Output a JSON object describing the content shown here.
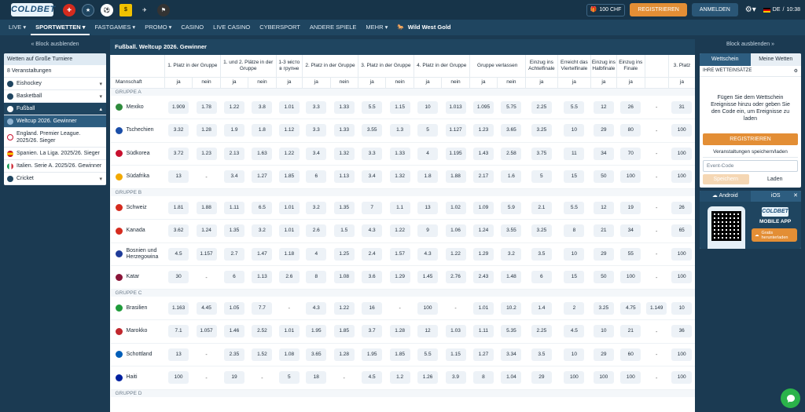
{
  "header": {
    "logo": "COLDBET",
    "balance": "100 CHF",
    "register": "REGISTRIEREN",
    "login": "ANMELDEN",
    "lang": "DE",
    "time": "10:38"
  },
  "nav": [
    "LIVE",
    "SPORTWETTEN",
    "FASTGAMES",
    "PROMO",
    "CASINO",
    "LIVE CASINO",
    "CYBERSPORT",
    "ANDERE SPIELE",
    "MEHR",
    "Wild West Gold"
  ],
  "left": {
    "hide": "Block ausblenden",
    "section": "Wetten auf Große Turniere",
    "events": "8 Veranstaltungen",
    "sports": {
      "eishockey": "Eishockey",
      "basketball": "Basketball",
      "fussball": "Fußball",
      "cricket": "Cricket"
    },
    "leagues": [
      "Weltcup 2026. Gewinner",
      "England. Premier League. 2025/26. Sieger",
      "Spanien. La Liga. 2025/26. Sieger",
      "Italien. Serie A. 2025/26. Gewinner"
    ]
  },
  "main": {
    "title": "Fußball. Weltcup 2026. Gewinner",
    "headers": [
      "1. Platz in der Gruppe",
      "1. und 2. Plätze in der Gruppe",
      "1-3 місто в групне",
      "2. Platz in der Gruppe",
      "3. Platz in der Gruppe",
      "4. Platz in der Gruppe",
      "Gruppe verlassen",
      "Einzug ins Achtelfinale",
      "Erreicht das Viertelfinale",
      "Einzug ins Halbfinale",
      "Einzug ins Finale",
      "3. Platz"
    ],
    "sub": {
      "team": "Mannschaft",
      "yes": "ja",
      "no": "nein"
    },
    "groups": [
      {
        "name": "GRUPPE A",
        "teams": [
          {
            "name": "Mexiko",
            "flag": "#2e8b3c",
            "odds": [
              "1.909",
              "1.78",
              "1.22",
              "3.8",
              "1.01",
              "3.3",
              "1.33",
              "5.5",
              "1.15",
              "10",
              "1.013",
              "1.095",
              "5.75",
              "2.25",
              "5.5",
              "12",
              "26",
              "-",
              "31"
            ]
          },
          {
            "name": "Tschechien",
            "flag": "#1b4ea8",
            "odds": [
              "3.32",
              "1.28",
              "1.9",
              "1.8",
              "1.12",
              "3.3",
              "1.33",
              "3.55",
              "1.3",
              "5",
              "1.127",
              "1.23",
              "3.65",
              "3.25",
              "10",
              "29",
              "80",
              "-",
              "100"
            ]
          },
          {
            "name": "Südkorea",
            "flag": "#c8102e",
            "odds": [
              "3.72",
              "1.23",
              "2.13",
              "1.63",
              "1.22",
              "3.4",
              "1.32",
              "3.3",
              "1.33",
              "4",
              "1.195",
              "1.43",
              "2.58",
              "3.75",
              "11",
              "34",
              "70",
              "-",
              "100"
            ]
          },
          {
            "name": "Südafrika",
            "flag": "#f2a900",
            "odds": [
              "13",
              "-",
              "3.4",
              "1.27",
              "1.85",
              "6",
              "1.13",
              "3.4",
              "1.32",
              "1.8",
              "1.88",
              "2.17",
              "1.6",
              "5",
              "15",
              "50",
              "100",
              "-",
              "100"
            ]
          }
        ]
      },
      {
        "name": "GRUPPE B",
        "teams": [
          {
            "name": "Schweiz",
            "flag": "#d52b1e",
            "odds": [
              "1.81",
              "1.88",
              "1.11",
              "6.5",
              "1.01",
              "3.2",
              "1.35",
              "7",
              "1.1",
              "13",
              "1.02",
              "1.09",
              "5.9",
              "2.1",
              "5.5",
              "12",
              "19",
              "-",
              "26"
            ]
          },
          {
            "name": "Kanada",
            "flag": "#d52b1e",
            "odds": [
              "3.62",
              "1.24",
              "1.35",
              "3.2",
              "1.01",
              "2.6",
              "1.5",
              "4.3",
              "1.22",
              "9",
              "1.06",
              "1.24",
              "3.55",
              "3.25",
              "8",
              "21",
              "34",
              "-",
              "65"
            ]
          },
          {
            "name": "Bosnien und Herzegowina",
            "flag": "#1f3c99",
            "odds": [
              "4.5",
              "1.157",
              "2.7",
              "1.47",
              "1.18",
              "4",
              "1.25",
              "2.4",
              "1.57",
              "4.3",
              "1.22",
              "1.29",
              "3.2",
              "3.5",
              "10",
              "29",
              "55",
              "-",
              "100"
            ]
          },
          {
            "name": "Katar",
            "flag": "#8a1538",
            "odds": [
              "30",
              "-",
              "6",
              "1.13",
              "2.6",
              "8",
              "1.08",
              "3.6",
              "1.29",
              "1.45",
              "2.76",
              "2.43",
              "1.48",
              "6",
              "15",
              "50",
              "100",
              "-",
              "100"
            ]
          }
        ]
      },
      {
        "name": "GRUPPE C",
        "teams": [
          {
            "name": "Brasilien",
            "flag": "#1f9b3a",
            "odds": [
              "1.163",
              "4.45",
              "1.05",
              "7.7",
              "-",
              "4.3",
              "1.22",
              "16",
              "-",
              "100",
              "-",
              "1.01",
              "10.2",
              "1.4",
              "2",
              "3.25",
              "4.75",
              "1.149",
              "10"
            ]
          },
          {
            "name": "Marokko",
            "flag": "#c1272d",
            "odds": [
              "7.1",
              "1.057",
              "1.46",
              "2.52",
              "1.01",
              "1.95",
              "1.85",
              "3.7",
              "1.28",
              "12",
              "1.03",
              "1.11",
              "5.35",
              "2.25",
              "4.5",
              "10",
              "21",
              "-",
              "36"
            ]
          },
          {
            "name": "Schottland",
            "flag": "#005eb8",
            "odds": [
              "13",
              "-",
              "2.35",
              "1.52",
              "1.08",
              "3.65",
              "1.28",
              "1.95",
              "1.85",
              "5.5",
              "1.15",
              "1.27",
              "3.34",
              "3.5",
              "10",
              "29",
              "60",
              "-",
              "100"
            ]
          },
          {
            "name": "Haiti",
            "flag": "#00209f",
            "odds": [
              "100",
              "-",
              "19",
              "-",
              "5",
              "18",
              "-",
              "4.5",
              "1.2",
              "1.26",
              "3.9",
              "8",
              "1.04",
              "29",
              "100",
              "100",
              "100",
              "-",
              "100"
            ]
          }
        ]
      },
      {
        "name": "GRUPPE D",
        "teams": []
      }
    ]
  },
  "right": {
    "hide": "Block ausblenden",
    "tab_slip": "Wettschein",
    "tab_mybets": "Meine Wetten",
    "slip_head": "IHRE WETTEINSÄTZE",
    "info": "Fügen Sie dem Wettschein Ereignisse hinzu oder geben Sie den Code ein, um Ereignisse zu laden",
    "register": "REGISTRIEREN",
    "save_load": "Veranstaltungen speichern/laden",
    "code_placeholder": "Event-Code",
    "save": "Speichern",
    "load": "Laden",
    "android": "Android",
    "ios": "iOS",
    "app_logo": "COLDBET",
    "app_title": "MOBILE APP",
    "app_dl": "Gratis herunterladen"
  }
}
